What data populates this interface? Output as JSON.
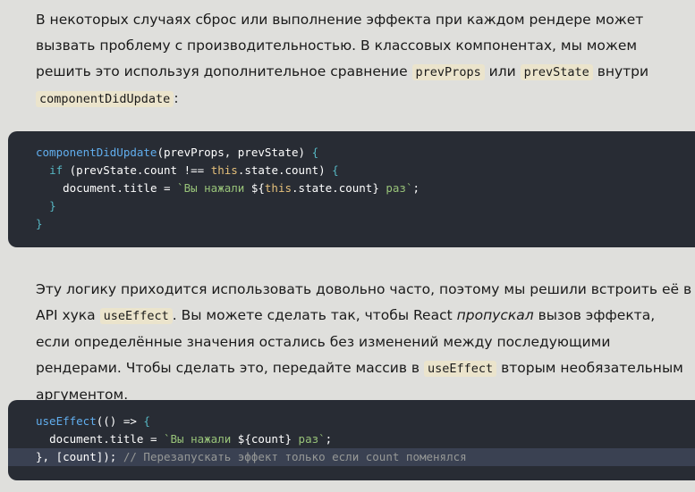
{
  "para1": {
    "t1": "В некоторых случаях сброс или выполнение эффекта при каждом рендере может вызвать проблему с производительностью. В классовых компонентах, мы можем решить это используя дополнительное сравнение ",
    "c1": "prevProps",
    "t2": " или ",
    "c2": "prevState",
    "t3": " внутри ",
    "c3": "componentDidUpdate",
    "t4": ":"
  },
  "code1": {
    "l1_fn": "componentDidUpdate",
    "l1_rest": "(prevProps, prevState) ",
    "l1_brace": "{",
    "l2_kw": "if",
    "l2_a": " (prevState.count !== ",
    "l2_this": "this",
    "l2_b": ".state.count) ",
    "l2_brace": "{",
    "l3_a": "document.title = ",
    "l3_str1": "`Вы нажали ",
    "l3_tpl_open": "${",
    "l3_this": "this",
    "l3_tpl_body": ".state.count",
    "l3_tpl_close": "}",
    "l3_str2": " раз`",
    "l3_end": ";",
    "l4_brace": "}",
    "l5_brace": "}"
  },
  "para2": {
    "t1": "Эту логику приходится использовать довольно часто, поэтому мы решили встроить её в API хука ",
    "c1": "useEffect",
    "t2": ". Вы можете сделать так, чтобы React ",
    "em": "пропускал",
    "t3": " вызов эффекта, если определённые значения остались без изменений между последующими рендерами. Чтобы сделать это, передайте массив в ",
    "c2": "useEffect",
    "t4": " вторым необязательным аргументом."
  },
  "code2": {
    "l1_fn": "useEffect",
    "l1_rest": "(() => ",
    "l1_brace": "{",
    "l2_a": "document.title = ",
    "l2_str1": "`Вы нажали ",
    "l2_tpl_open": "${",
    "l2_tpl_body": "count",
    "l2_tpl_close": "}",
    "l2_str2": " раз`",
    "l2_end": ";",
    "l3_a": "}, [count]);",
    "l3_comment": " // Перезапускать эффект только если count поменялся"
  }
}
